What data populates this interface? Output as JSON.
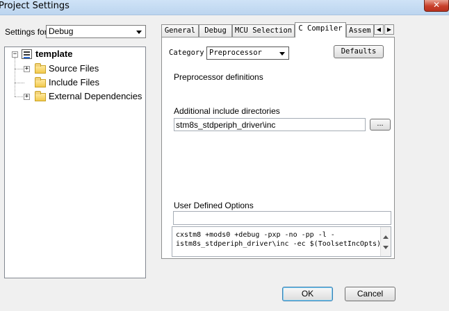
{
  "window": {
    "title": "Project Settings",
    "close_glyph": "✕"
  },
  "settings_for": {
    "label": "Settings for:",
    "value": "Debug"
  },
  "tree": {
    "root": "template",
    "children": [
      "Source Files",
      "Include Files",
      "External Dependencies"
    ]
  },
  "tabs": [
    "General",
    "Debug",
    "MCU Selection",
    "C Compiler",
    "Assem"
  ],
  "active_tab": "C Compiler",
  "compiler": {
    "category_label": "Category",
    "category_value": "Preprocessor",
    "defaults_button": "Defaults",
    "preprocessor_label": "Preprocessor definitions",
    "include_dirs_label": "Additional include directories",
    "include_dirs_value": "stm8s_stdperiph_driver\\inc",
    "browse_button": "...",
    "user_options_label": "User Defined Options",
    "user_options_value": "",
    "command_line_1": "cxstm8 +mods0 +debug -pxp -no -pp -l -",
    "command_line_2": "istm8s_stdperiph_driver\\inc -ec $(ToolsetIncOpts)"
  },
  "footer": {
    "ok": "OK",
    "cancel": "Cancel"
  }
}
